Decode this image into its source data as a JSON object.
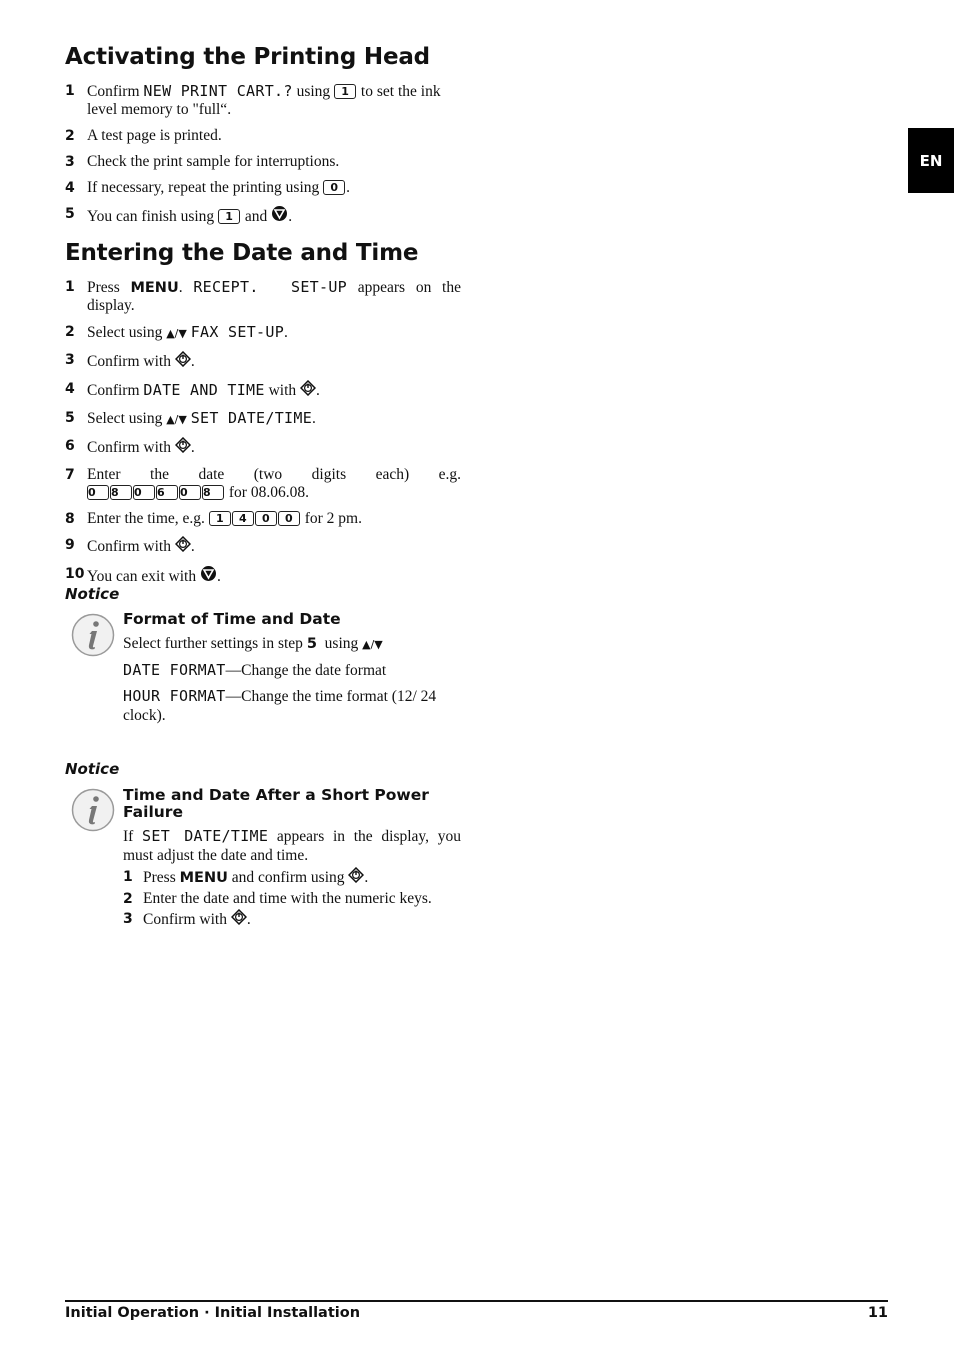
{
  "side_tab": {
    "language": "EN"
  },
  "section1": {
    "title": "Activating the Printing Head",
    "steps": [
      {
        "num": "1",
        "pre": "Confirm ",
        "lcd": "NEW PRINT CART.?",
        "mid": " using ",
        "key": "1",
        "post": " to set the ink level memory to \"full“."
      },
      {
        "num": "2",
        "text": "A test page is printed."
      },
      {
        "num": "3",
        "text": "Check the print sample for interruptions."
      },
      {
        "num": "4",
        "pre": "If necessary, repeat the printing using ",
        "key": "0",
        "post": "."
      },
      {
        "num": "5",
        "pre": "You can finish using ",
        "key": "1",
        "mid": " and ",
        "post": "."
      }
    ]
  },
  "section2": {
    "title": "Entering the Date and Time",
    "steps": [
      {
        "num": "1",
        "pre": "Press ",
        "bold": "MENU",
        "mid": ". ",
        "lcd": "RECEPT.  SET-UP",
        "post": " appears on the display."
      },
      {
        "num": "2",
        "pre": "Select using ",
        "arrows": "▲/▼",
        "lcd": "FAX SET-UP",
        "post": "."
      },
      {
        "num": "3",
        "pre": "Confirm with ",
        "post": "."
      },
      {
        "num": "4",
        "pre": "Confirm ",
        "lcd": "DATE AND TIME",
        "mid": " with ",
        "post": "."
      },
      {
        "num": "5",
        "pre": "Select using ",
        "arrows": "▲/▼",
        "lcd": "SET DATE/TIME",
        "post": "."
      },
      {
        "num": "6",
        "pre": "Confirm with ",
        "post": "."
      },
      {
        "num": "7",
        "pre": "Enter the date (two digits each) e.g. ",
        "keys": [
          "0",
          "8",
          "0",
          "6",
          "0",
          "8"
        ],
        "post": " for 08.06.08."
      },
      {
        "num": "8",
        "pre": "Enter the time, e.g. ",
        "keys": [
          "1",
          "4",
          "0",
          "0"
        ],
        "post": " for 2 pm."
      },
      {
        "num": "9",
        "pre": "Confirm with ",
        "post": "."
      },
      {
        "num": "10",
        "pre": "You can exit with ",
        "post": "."
      }
    ]
  },
  "notice1": {
    "label": "Notice",
    "title": "Format of Time and Date",
    "line1_pre": "Select further settings in step ",
    "line1_step": "5",
    "line1_post": "  using ",
    "arrows": "▲/▼",
    "items": [
      {
        "lcd": "DATE FORMAT",
        "text": "—Change the date format"
      },
      {
        "lcd": "HOUR FORMAT",
        "text": "—Change the time format (12/ 24 clock)."
      }
    ]
  },
  "notice2": {
    "label": "Notice",
    "title": "Time and Date After a Short Power Failure",
    "intro_pre": "If ",
    "intro_lcd": "SET DATE/TIME",
    "intro_post": " appears in the display, you must adjust the date and time.",
    "steps": [
      {
        "num": "1",
        "pre": "Press ",
        "bold": "MENU",
        "post": " and confirm using ",
        "end": "."
      },
      {
        "num": "2",
        "text": "Enter the date and time with the numeric keys."
      },
      {
        "num": "3",
        "pre": "Confirm with ",
        "end": "."
      }
    ]
  },
  "footer": {
    "section": "Initial Operation · Initial Installation",
    "page": "11"
  }
}
